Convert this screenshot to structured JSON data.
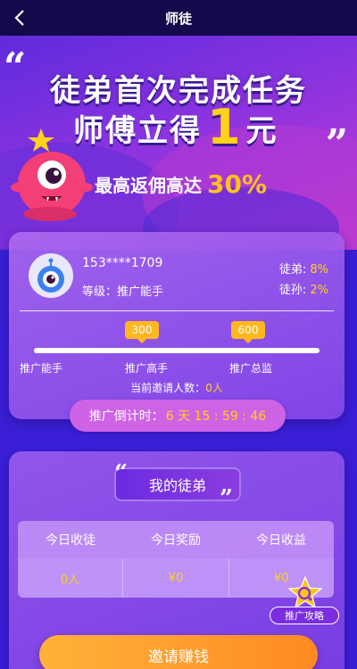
{
  "header": {
    "title": "师徒",
    "back_icon": "chevron-left-icon"
  },
  "banner": {
    "line1": "徒弟首次完成任务",
    "line2_prefix": "师傅立得",
    "line2_amount": "1",
    "line2_suffix": "元",
    "line3_text": "最高返佣高达",
    "line3_percent": "30%",
    "quote_open": "“",
    "quote_close": "”"
  },
  "user": {
    "phone": "153****1709",
    "level_label": "等级：推广能手",
    "ratio1_label": "徒弟: ",
    "ratio1_value": "8%",
    "ratio2_label": "徒孙: ",
    "ratio2_value": "2%"
  },
  "progress": {
    "markers": [
      "300",
      "600"
    ],
    "levels": [
      "推广能手",
      "推广高手",
      "推广总监"
    ],
    "invites_label": "当前邀请人数：",
    "invites_value": "0人"
  },
  "countdown": {
    "label": "推广倒计时：",
    "value": "6 天 15 : 59 : 46"
  },
  "apprentice": {
    "title": "我的徒弟",
    "headers": [
      "今日收徒",
      "今日奖励",
      "今日收益"
    ],
    "values": [
      "0人",
      "¥0",
      "¥0"
    ]
  },
  "guide": {
    "label": "推广攻略",
    "icon": "search-star-icon"
  },
  "invite_button": "邀请赚钱",
  "colors": {
    "accent_yellow": "#ffd21a",
    "button_orange": "#ff8a22",
    "header_bg": "#120a4a"
  }
}
